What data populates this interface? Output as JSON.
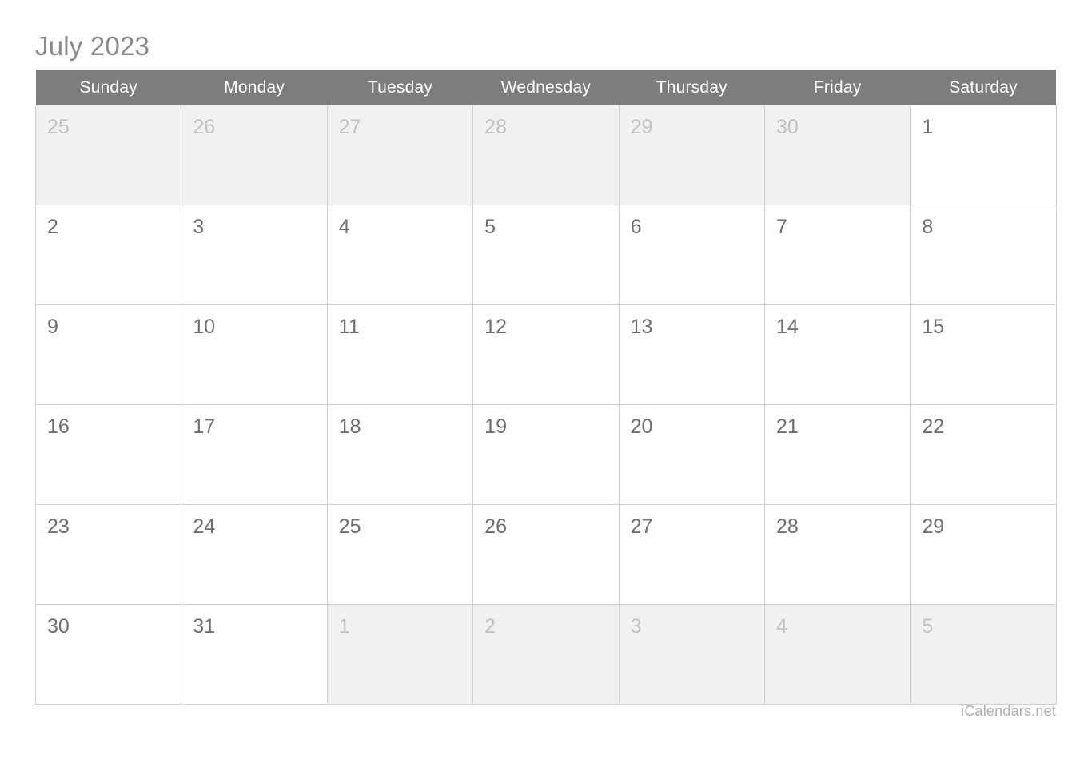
{
  "title": "July 2023",
  "weekdays": [
    "Sunday",
    "Monday",
    "Tuesday",
    "Wednesday",
    "Thursday",
    "Friday",
    "Saturday"
  ],
  "weeks": [
    [
      {
        "n": "25",
        "other": true
      },
      {
        "n": "26",
        "other": true
      },
      {
        "n": "27",
        "other": true
      },
      {
        "n": "28",
        "other": true
      },
      {
        "n": "29",
        "other": true
      },
      {
        "n": "30",
        "other": true
      },
      {
        "n": "1",
        "other": false
      }
    ],
    [
      {
        "n": "2",
        "other": false
      },
      {
        "n": "3",
        "other": false
      },
      {
        "n": "4",
        "other": false
      },
      {
        "n": "5",
        "other": false
      },
      {
        "n": "6",
        "other": false
      },
      {
        "n": "7",
        "other": false
      },
      {
        "n": "8",
        "other": false
      }
    ],
    [
      {
        "n": "9",
        "other": false
      },
      {
        "n": "10",
        "other": false
      },
      {
        "n": "11",
        "other": false
      },
      {
        "n": "12",
        "other": false
      },
      {
        "n": "13",
        "other": false
      },
      {
        "n": "14",
        "other": false
      },
      {
        "n": "15",
        "other": false
      }
    ],
    [
      {
        "n": "16",
        "other": false
      },
      {
        "n": "17",
        "other": false
      },
      {
        "n": "18",
        "other": false
      },
      {
        "n": "19",
        "other": false
      },
      {
        "n": "20",
        "other": false
      },
      {
        "n": "21",
        "other": false
      },
      {
        "n": "22",
        "other": false
      }
    ],
    [
      {
        "n": "23",
        "other": false
      },
      {
        "n": "24",
        "other": false
      },
      {
        "n": "25",
        "other": false
      },
      {
        "n": "26",
        "other": false
      },
      {
        "n": "27",
        "other": false
      },
      {
        "n": "28",
        "other": false
      },
      {
        "n": "29",
        "other": false
      }
    ],
    [
      {
        "n": "30",
        "other": false
      },
      {
        "n": "31",
        "other": false
      },
      {
        "n": "1",
        "other": true
      },
      {
        "n": "2",
        "other": true
      },
      {
        "n": "3",
        "other": true
      },
      {
        "n": "4",
        "other": true
      },
      {
        "n": "5",
        "other": true
      }
    ]
  ],
  "footer": "iCalendars.net",
  "colors": {
    "header_bg": "#7d7d7d",
    "header_text": "#ffffff",
    "title_text": "#8a8a8a",
    "day_text": "#6e6e6e",
    "other_month_bg": "#f1f1f1",
    "other_month_text": "#c2c2c2",
    "grid_line": "#cfcfcf",
    "footer_text": "#b0b0b0"
  }
}
